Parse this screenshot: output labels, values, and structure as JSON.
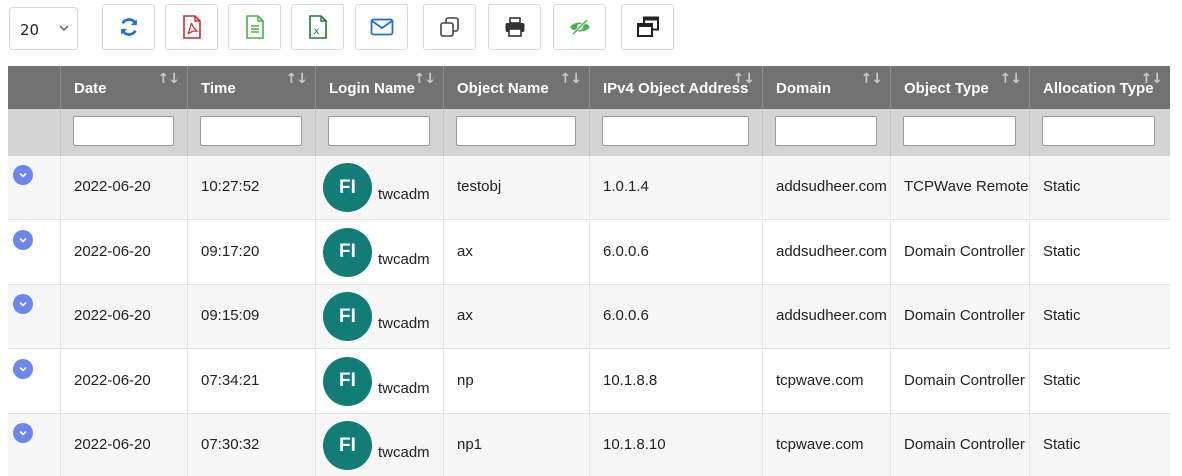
{
  "toolbar": {
    "page_size": "20",
    "buttons": [
      {
        "name": "refresh-button",
        "icon": "refresh-icon",
        "color": "#1f6fd1"
      },
      {
        "name": "export-pdf-button",
        "icon": "pdf-icon",
        "color": "#cc2b2b"
      },
      {
        "name": "export-csv-button",
        "icon": "text-file-icon",
        "color": "#4caf50"
      },
      {
        "name": "export-excel-button",
        "icon": "excel-icon",
        "color": "#1e7a3c"
      },
      {
        "name": "email-button",
        "icon": "envelope-icon",
        "color": "#1f6fd1"
      },
      {
        "name": "copy-button",
        "icon": "copy-icon",
        "color": "#444444"
      },
      {
        "name": "print-button",
        "icon": "printer-icon",
        "color": "#333333"
      },
      {
        "name": "column-visibility-button",
        "icon": "eye-slash-icon",
        "color": "#4caf50"
      },
      {
        "name": "restore-window-button",
        "icon": "window-restore-icon",
        "color": "#222222"
      }
    ]
  },
  "table": {
    "columns": [
      {
        "key": "expand",
        "label": ""
      },
      {
        "key": "date",
        "label": "Date"
      },
      {
        "key": "time",
        "label": "Time"
      },
      {
        "key": "login",
        "label": "Login Name"
      },
      {
        "key": "object_name",
        "label": "Object Name"
      },
      {
        "key": "ipv4",
        "label": "IPv4 Object Address"
      },
      {
        "key": "domain",
        "label": "Domain"
      },
      {
        "key": "object_type",
        "label": "Object Type"
      },
      {
        "key": "allocation_type",
        "label": "Allocation Type"
      }
    ],
    "rows": [
      {
        "date": "2022-06-20",
        "time": "10:27:52",
        "avatar": "FI",
        "login": "twcadm",
        "object_name": "testobj",
        "ipv4": "1.0.1.4",
        "domain": "addsudheer.com",
        "object_type": "TCPWave Remote",
        "allocation_type": "Static"
      },
      {
        "date": "2022-06-20",
        "time": "09:17:20",
        "avatar": "FI",
        "login": "twcadm",
        "object_name": "ax",
        "ipv4": "6.0.0.6",
        "domain": "addsudheer.com",
        "object_type": "Domain Controller",
        "allocation_type": "Static"
      },
      {
        "date": "2022-06-20",
        "time": "09:15:09",
        "avatar": "FI",
        "login": "twcadm",
        "object_name": "ax",
        "ipv4": "6.0.0.6",
        "domain": "addsudheer.com",
        "object_type": "Domain Controller",
        "allocation_type": "Static"
      },
      {
        "date": "2022-06-20",
        "time": "07:34:21",
        "avatar": "FI",
        "login": "twcadm",
        "object_name": "np",
        "ipv4": "10.1.8.8",
        "domain": "tcpwave.com",
        "object_type": "Domain Controller",
        "allocation_type": "Static"
      },
      {
        "date": "2022-06-20",
        "time": "07:30:32",
        "avatar": "FI",
        "login": "twcadm",
        "object_name": "np1",
        "ipv4": "10.1.8.10",
        "domain": "tcpwave.com",
        "object_type": "Domain Controller",
        "allocation_type": "Static"
      }
    ]
  },
  "colors": {
    "header_bg": "#727272",
    "filter_bg": "#d4d4d4",
    "avatar_bg": "#127c77",
    "expand_bg": "#6c86ef"
  }
}
